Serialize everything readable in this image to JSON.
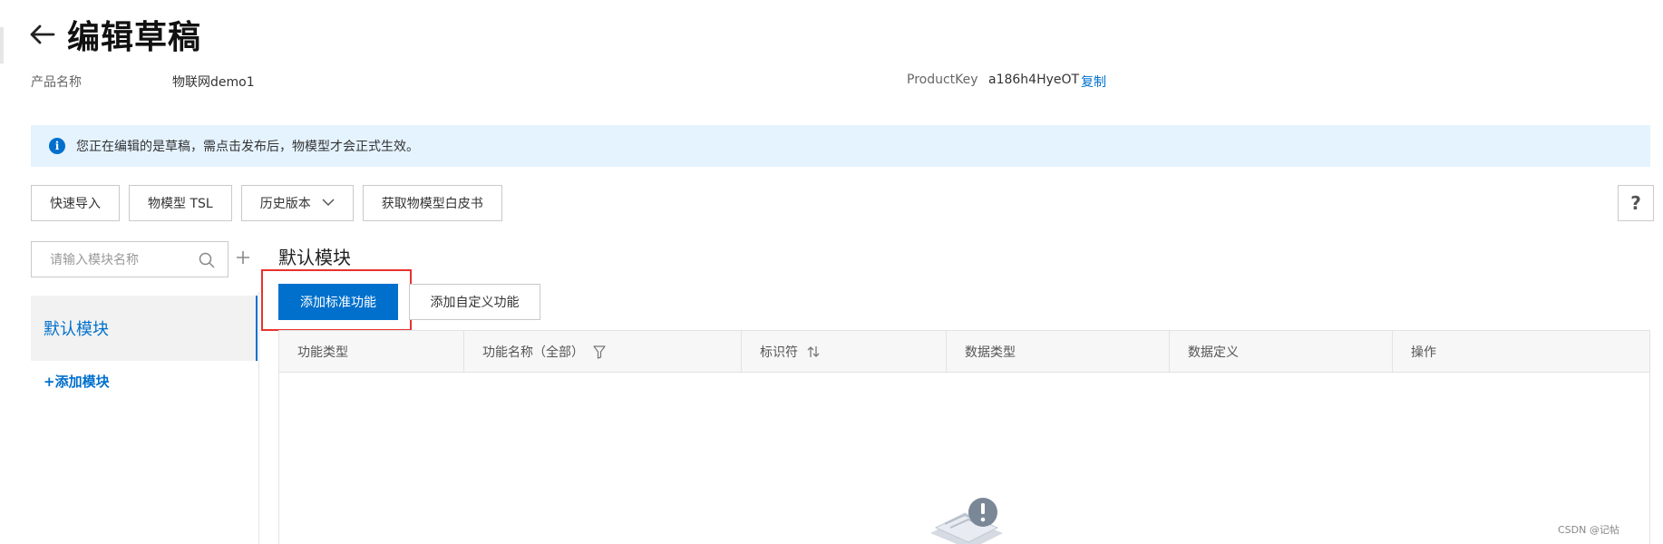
{
  "header": {
    "title": "编辑草稿"
  },
  "product": {
    "name_label": "产品名称",
    "name_value": "物联网demo1",
    "key_label": "ProductKey",
    "key_value": "a186h4HyeOT",
    "copy_label": "复制"
  },
  "notice": {
    "text": "您正在编辑的是草稿，需点击发布后，物模型才会正式生效。"
  },
  "toolbar": {
    "buttons": [
      "快速导入",
      "物模型 TSL",
      "历史版本",
      "获取物模型白皮书"
    ],
    "help": "?"
  },
  "sidebar": {
    "search_placeholder": "请输入模块名称",
    "modules": [
      {
        "label": "默认模块"
      }
    ],
    "add_module_label": "+添加模块"
  },
  "main": {
    "section_title": "默认模块",
    "add_standard_label": "添加标准功能",
    "add_custom_label": "添加自定义功能",
    "columns": [
      "功能类型",
      "功能名称（全部）",
      "标识符",
      "数据类型",
      "数据定义",
      "操作"
    ]
  },
  "watermark": "CSDN @记帖",
  "colors": {
    "primary": "#0070cc",
    "notice_bg": "#e5f3ff",
    "highlight": "#e8322f"
  }
}
